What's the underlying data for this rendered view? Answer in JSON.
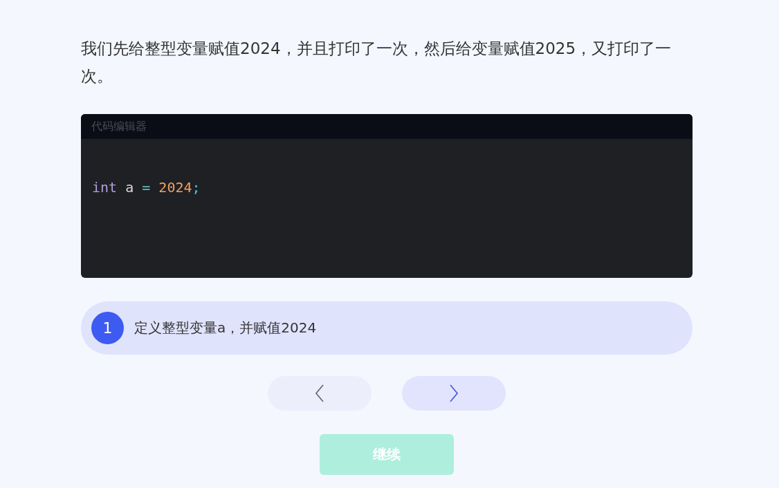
{
  "intro": "我们先给整型变量赋值2024，并且打印了一次，然后给变量赋值2025，又打印了一次。",
  "editor": {
    "title": "代码编辑器",
    "lines": [
      [
        {
          "kind": "keyword",
          "text": "int"
        },
        {
          "kind": "plain",
          "text": " a "
        },
        {
          "kind": "operator",
          "text": "= "
        },
        {
          "kind": "number",
          "text": "2024"
        },
        {
          "kind": "punct",
          "text": ";"
        }
      ]
    ]
  },
  "step": {
    "number": "1",
    "text": "定义整型变量a，并赋值2024"
  },
  "nav": {
    "prev_disabled": true,
    "next_disabled": false
  },
  "continue": {
    "label": "继续",
    "disabled": true
  }
}
